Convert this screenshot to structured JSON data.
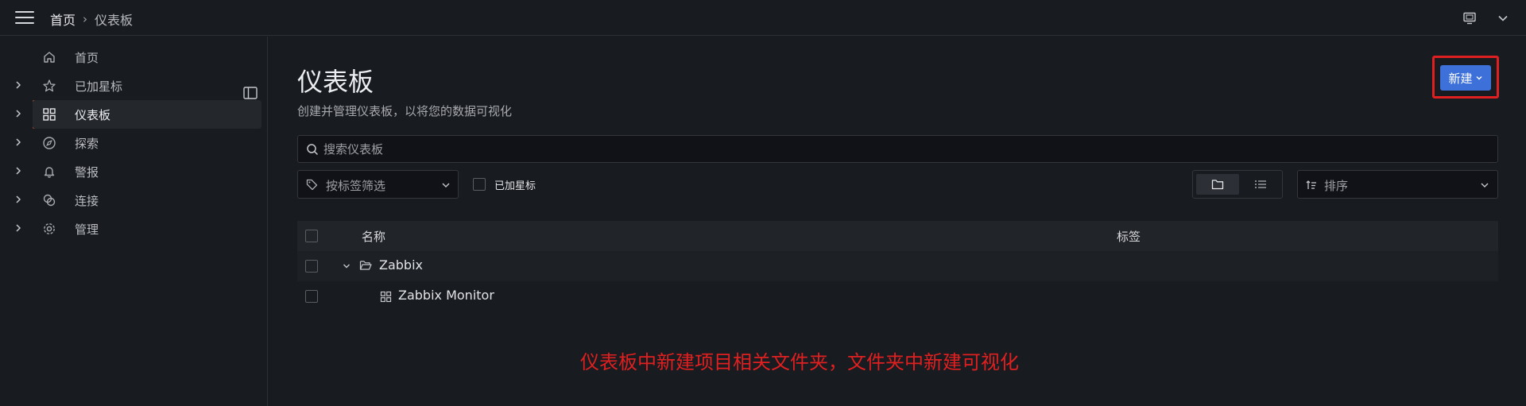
{
  "topbar": {
    "breadcrumb_home": "首页",
    "breadcrumb_separator": "›",
    "breadcrumb_current": "仪表板"
  },
  "sidebar": {
    "items": [
      {
        "label": "首页",
        "icon": "home-icon",
        "expandable": false
      },
      {
        "label": "已加星标",
        "icon": "star-icon",
        "expandable": true
      },
      {
        "label": "仪表板",
        "icon": "dashboard-grid-icon",
        "expandable": true,
        "active": true
      },
      {
        "label": "探索",
        "icon": "compass-icon",
        "expandable": true
      },
      {
        "label": "警报",
        "icon": "bell-icon",
        "expandable": true
      },
      {
        "label": "连接",
        "icon": "link-icon",
        "expandable": true
      },
      {
        "label": "管理",
        "icon": "gear-icon",
        "expandable": true
      }
    ]
  },
  "main": {
    "title": "仪表板",
    "subtitle": "创建并管理仪表板，以将您的数据可视化",
    "new_button_label": "新建",
    "search_placeholder": "搜索仪表板",
    "tag_filter_label": "按标签筛选",
    "starred_filter_label": "已加星标",
    "sort_label": "排序",
    "table": {
      "columns": [
        "名称",
        "标签"
      ],
      "rows": [
        {
          "type": "folder",
          "name": "Zabbix",
          "expanded": true
        },
        {
          "type": "dashboard",
          "name": "Zabbix Monitor"
        }
      ]
    }
  },
  "annotation": "仪表板中新建项目相关文件夹，文件夹中新建可视化",
  "colors": {
    "accent_orange": "#f46a29",
    "primary_blue": "#3d71d9",
    "annotation_red": "#e02020",
    "background": "#181b1f"
  }
}
